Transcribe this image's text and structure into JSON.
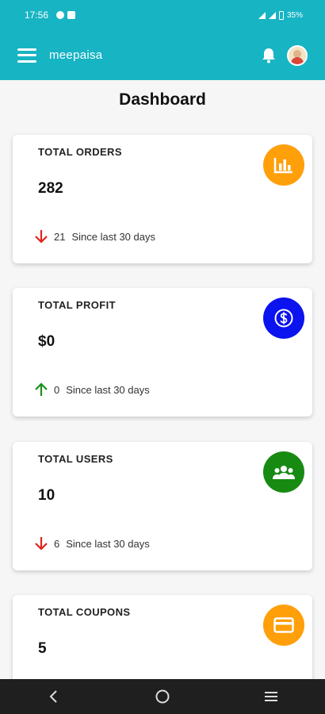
{
  "status_bar": {
    "time": "17:56",
    "battery": "35%"
  },
  "app_bar": {
    "title": "meepaisa"
  },
  "page": {
    "title": "Dashboard"
  },
  "cards": [
    {
      "title": "TOTAL ORDERS",
      "value": "282",
      "trend": "down",
      "change": "21",
      "caption": "Since last 30 days",
      "icon": "bar-chart-icon",
      "color": "#ff9f0a"
    },
    {
      "title": "TOTAL PROFIT",
      "value": "$0",
      "trend": "up",
      "change": "0",
      "caption": "Since last 30 days",
      "icon": "dollar-icon",
      "color": "#0b13ef"
    },
    {
      "title": "TOTAL USERS",
      "value": "10",
      "trend": "down",
      "change": "6",
      "caption": "Since last 30 days",
      "icon": "users-icon",
      "color": "#178a12"
    },
    {
      "title": "TOTAL COUPONS",
      "value": "5",
      "icon": "coupon-card-icon",
      "color": "#ff9f0a"
    }
  ],
  "colors": {
    "primary": "#17b4c4",
    "trend_down": "#e0231c",
    "trend_up": "#1a8f1a"
  }
}
